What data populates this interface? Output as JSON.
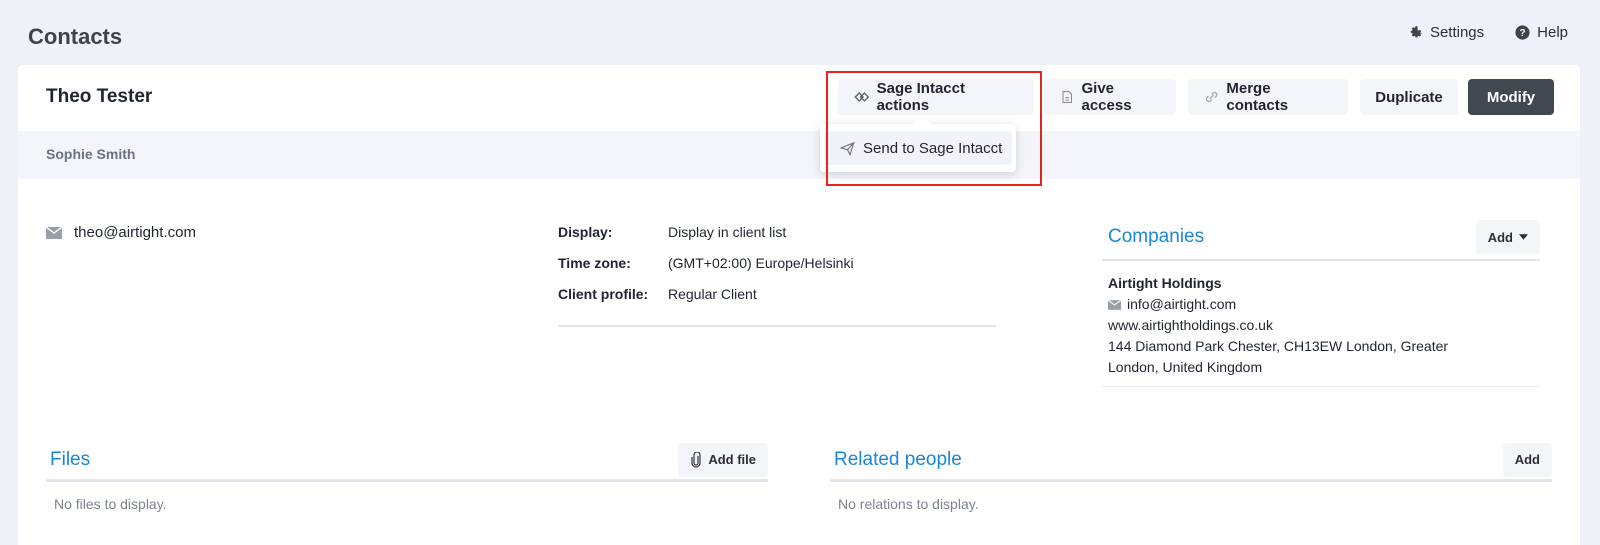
{
  "page": {
    "title": "Contacts"
  },
  "top_links": {
    "settings": "Settings",
    "help": "Help"
  },
  "contact": {
    "name": "Theo Tester",
    "owner": "Sophie Smith",
    "email": "theo@airtight.com"
  },
  "actions": {
    "sage": "Sage Intacct actions",
    "give_access": "Give access",
    "merge": "Merge contacts",
    "duplicate": "Duplicate",
    "modify": "Modify"
  },
  "dropdown": {
    "items": [
      {
        "label": "Send to Sage Intacct"
      }
    ]
  },
  "details": {
    "rows": [
      {
        "key": "Display:",
        "value": "Display in client list"
      },
      {
        "key": "Time zone:",
        "value": "(GMT+02:00) Europe/Helsinki"
      },
      {
        "key": "Client profile:",
        "value": "Regular Client"
      }
    ]
  },
  "companies": {
    "title": "Companies",
    "add_label": "Add",
    "item": {
      "name": "Airtight Holdings",
      "email": "info@airtight.com",
      "website": "www.airtightholdings.co.uk",
      "address_line1": "144 Diamond Park Chester, CH13EW London, Greater",
      "address_line2": "London, United Kingdom"
    }
  },
  "files": {
    "title": "Files",
    "add_label": "Add file",
    "empty": "No files to display."
  },
  "related": {
    "title": "Related people",
    "add_label": "Add",
    "empty": "No relations to display."
  },
  "colors": {
    "accent": "#1b87d6",
    "modify_bg": "#424852",
    "highlight": "#e5231f",
    "page_bg": "#eef1f8"
  }
}
